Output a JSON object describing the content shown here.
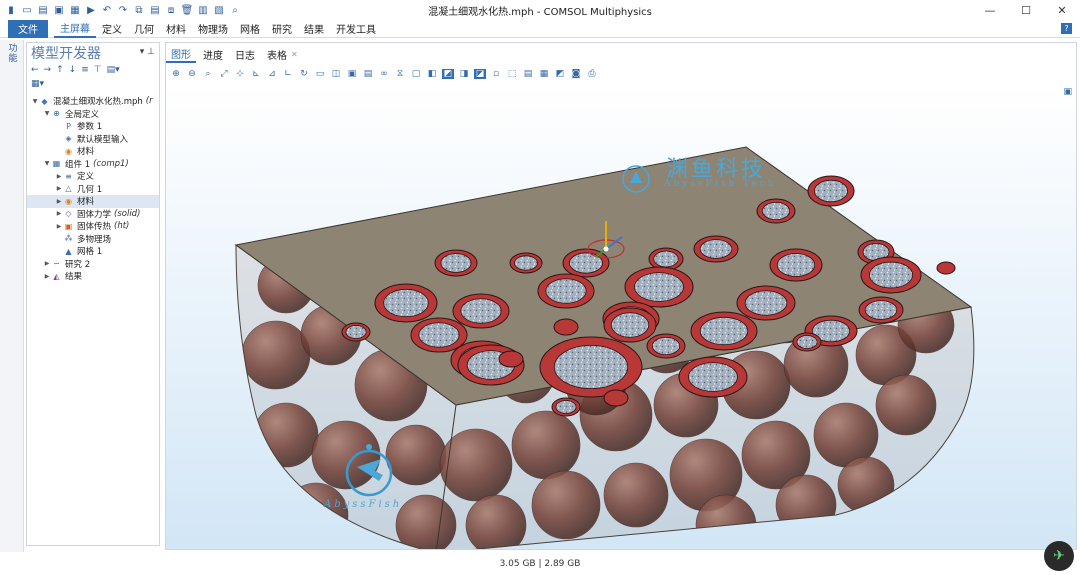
{
  "window": {
    "title": "混凝土细观水化热.mph - COMSOL Multiphysics",
    "controls": [
      "—",
      "☐",
      "✕"
    ]
  },
  "menu": {
    "file": "文件",
    "items": [
      "主屏幕",
      "定义",
      "几何",
      "材料",
      "物理场",
      "网格",
      "研究",
      "结果",
      "开发工具"
    ],
    "help": "?"
  },
  "left_strip": {
    "label": "功能"
  },
  "model_builder": {
    "title": "模型开发器",
    "tree": [
      {
        "label": "混凝土细观水化热.mph",
        "suffix": "(r",
        "icon": "model-icon",
        "level": 0,
        "expanded": true
      },
      {
        "label": "全局定义",
        "suffix": "",
        "icon": "globe-icon",
        "level": 1,
        "expanded": true
      },
      {
        "label": "参数 1",
        "suffix": "",
        "icon": "parameter-icon",
        "level": 2
      },
      {
        "label": "默认模型输入",
        "suffix": "",
        "icon": "model-input-icon",
        "level": 2
      },
      {
        "label": "材料",
        "suffix": "",
        "icon": "material-icon",
        "level": 2
      },
      {
        "label": "组件 1",
        "suffix": "(comp1)",
        "icon": "component-icon",
        "level": 1,
        "expanded": true
      },
      {
        "label": "定义",
        "suffix": "",
        "icon": "definitions-icon",
        "level": 2
      },
      {
        "label": "几何 1",
        "suffix": "",
        "icon": "geometry-icon",
        "level": 2
      },
      {
        "label": "材料",
        "suffix": "",
        "icon": "material-icon",
        "level": 2,
        "selected": true
      },
      {
        "label": "固体力学",
        "suffix": "(solid)",
        "icon": "solid-mechanics-icon",
        "level": 2
      },
      {
        "label": "固体传热",
        "suffix": "(ht)",
        "icon": "heat-transfer-icon",
        "level": 2
      },
      {
        "label": "多物理场",
        "suffix": "",
        "icon": "multiphysics-icon",
        "level": 2
      },
      {
        "label": "网格 1",
        "suffix": "",
        "icon": "mesh-icon",
        "level": 2
      },
      {
        "label": "研究 2",
        "suffix": "",
        "icon": "study-icon",
        "level": 1
      },
      {
        "label": "结果",
        "suffix": "",
        "icon": "results-icon",
        "level": 1
      }
    ]
  },
  "graphics": {
    "tabs": [
      {
        "label": "图形",
        "active": true
      },
      {
        "label": "进度",
        "active": false
      },
      {
        "label": "日志",
        "active": false
      },
      {
        "label": "表格",
        "active": false,
        "closable": true
      }
    ],
    "watermark_top": "渊鱼科技",
    "watermark_top_sub": "AbyssFish Tech",
    "watermark_logo": "AbyssFish",
    "colors": {
      "matrix": "#8d8474",
      "aggregate_ring": "#b83838",
      "aggregate_core": "#9aa7b8",
      "sphere": "#7a3c30",
      "background_top": "#ffffff",
      "background_bottom": "#d2e6f6"
    }
  },
  "status": {
    "memory": "3.05 GB | 2.89 GB"
  }
}
